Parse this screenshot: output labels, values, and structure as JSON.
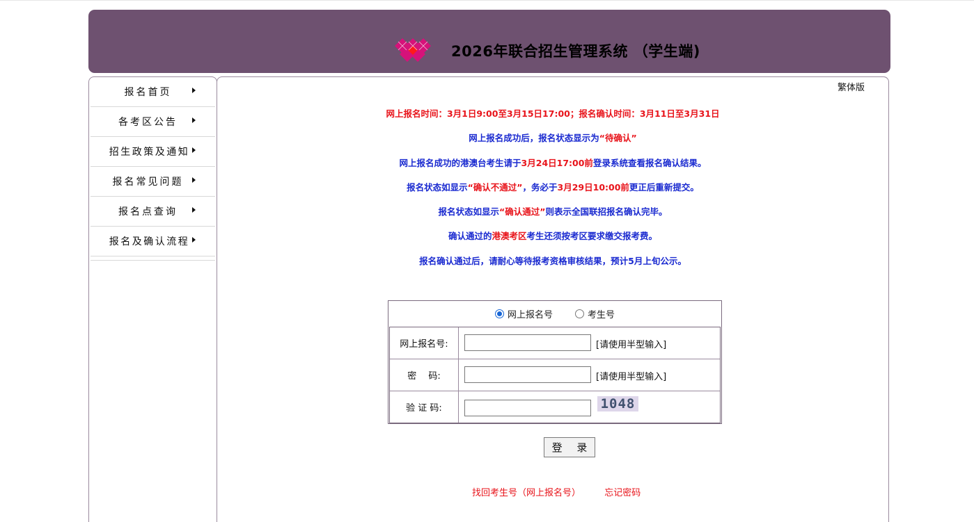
{
  "header": {
    "title": "2026年联合招生管理系统 （学生端)"
  },
  "sidebar": {
    "items": [
      {
        "label": "报名首页"
      },
      {
        "label": "各考区公告"
      },
      {
        "label": "招生政策及通知"
      },
      {
        "label": "报名常见问题"
      },
      {
        "label": "报名点查询"
      },
      {
        "label": "报名及确认流程"
      }
    ]
  },
  "main": {
    "traditional_link": "繁体版",
    "notices": {
      "line1": "网上报名时间：3月1日9:00至3月15日17:00；报名确认时间：3月11日至3月31日",
      "line2_a": "网上报名成功后，报名状态显示为",
      "line2_b": "“待确认”",
      "line3_a": "网上报名成功的港澳台考生请于",
      "line3_b": "3月24日17:00前",
      "line3_c": "登录系统查看报名确认结果。",
      "line4_a": "报名状态如显示",
      "line4_b": "“确认不通过”",
      "line4_c": "，务必于",
      "line4_d": "3月29日10:00前",
      "line4_e": "更正后重新提交。",
      "line5_a": "报名状态如显示",
      "line5_b": "“确认通过”",
      "line5_c": "则表示全国联招报名确认完毕。",
      "line6_a": "确认通过的",
      "line6_b": "港澳考区",
      "line6_c": "考生还须按考区要求缴交报考费。",
      "line7": "报名确认通过后，请耐心等待报考资格审核结果，预计5月上旬公示。"
    },
    "form": {
      "radio_options": [
        {
          "label": "网上报名号",
          "selected": true
        },
        {
          "label": "考生号",
          "selected": false
        }
      ],
      "fields": {
        "reg_no": {
          "label": "网上报名号:",
          "value": "",
          "hint": "[请使用半型输入]"
        },
        "password": {
          "label": "密　 码:",
          "value": "",
          "hint": "[请使用半型输入]"
        },
        "captcha": {
          "label": "验 证 码:",
          "value": "",
          "code": "1048"
        }
      },
      "login_label": "登 录"
    },
    "links": {
      "recover_id": "找回考生号（网上报名号）",
      "forgot_password": "忘记密码"
    }
  },
  "colors": {
    "header_bg": "#6e5170",
    "notice_blue": "#1a2ad0",
    "notice_red": "#e8141b",
    "radio_accent": "#1766d6"
  }
}
